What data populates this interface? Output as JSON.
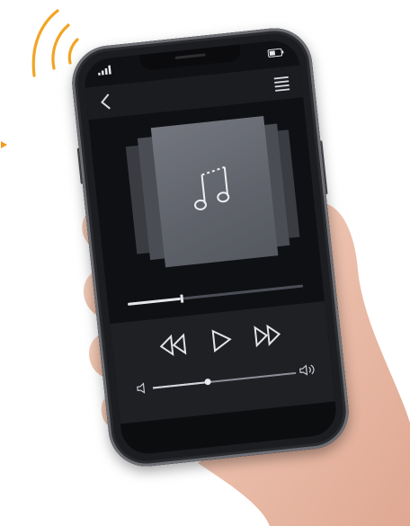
{
  "colors": {
    "accent_waves": "#f2a423",
    "phone_frame": "#1c1d20",
    "screen_background": "#101114",
    "control_panel": "#1f2024",
    "album_art": "#666971",
    "progress_fill": "#e4e6ea",
    "indicator_arrow": "#f29c1f"
  },
  "icons": {
    "status_signal": "signal-icon",
    "status_battery": "battery-icon",
    "nav_back": "back-icon",
    "nav_menu": "menu-icon",
    "artwork": "music-note-icon",
    "rewind": "rewind-icon",
    "play": "play-icon",
    "fast_forward": "fast-forward-icon",
    "volume_low": "volume-low-icon",
    "volume_high": "volume-high-icon",
    "waves": "wireless-waves-icon",
    "arrow": "triangle-arrow-icon"
  },
  "player": {
    "progress": 0.3,
    "volume": 0.38
  }
}
